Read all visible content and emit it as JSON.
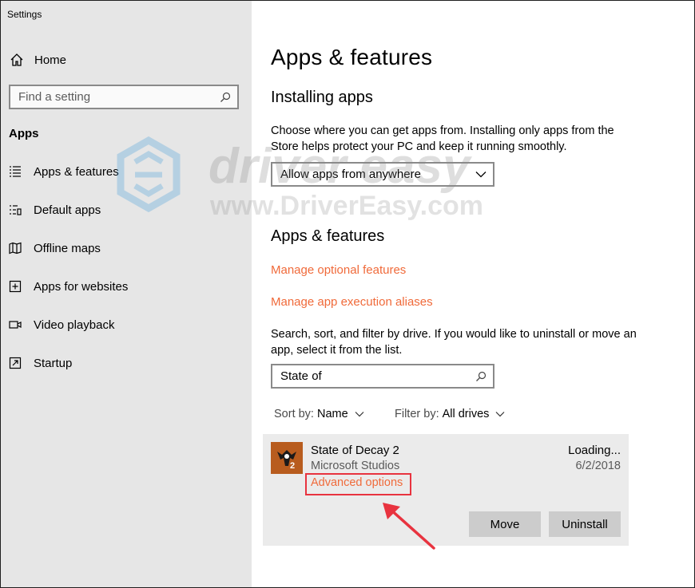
{
  "window": {
    "title": "Settings"
  },
  "sidebar": {
    "home_label": "Home",
    "search_placeholder": "Find a setting",
    "section_title": "Apps",
    "items": [
      {
        "label": "Apps & features",
        "icon": "list-icon"
      },
      {
        "label": "Default apps",
        "icon": "default-apps-icon"
      },
      {
        "label": "Offline maps",
        "icon": "map-icon"
      },
      {
        "label": "Apps for websites",
        "icon": "open-in-icon"
      },
      {
        "label": "Video playback",
        "icon": "video-icon"
      },
      {
        "label": "Startup",
        "icon": "startup-icon"
      }
    ]
  },
  "main": {
    "title": "Apps & features",
    "installing": {
      "heading": "Installing apps",
      "description": "Choose where you can get apps from. Installing only apps from the Store helps protect your PC and keep it running smoothly.",
      "dropdown_value": "Allow apps from anywhere"
    },
    "features": {
      "heading": "Apps & features",
      "link_optional": "Manage optional features",
      "link_aliases": "Manage app execution aliases",
      "description": "Search, sort, and filter by drive. If you would like to uninstall or move an app, select it from the list.",
      "search_value": "State of",
      "sort_label": "Sort by:",
      "sort_value": "Name",
      "filter_label": "Filter by:",
      "filter_value": "All drives"
    },
    "app": {
      "name": "State of Decay 2",
      "publisher": "Microsoft Studios",
      "advanced_link": "Advanced options",
      "size": "Loading...",
      "date": "6/2/2018",
      "move_label": "Move",
      "uninstall_label": "Uninstall"
    }
  },
  "watermark": {
    "brand": "driver easy",
    "url": "www.DriverEasy.com"
  },
  "colors": {
    "accent": "#f06a3a",
    "highlight": "#e8333f",
    "sidebar_bg": "#e6e6e6",
    "card_bg": "#ebebeb"
  }
}
